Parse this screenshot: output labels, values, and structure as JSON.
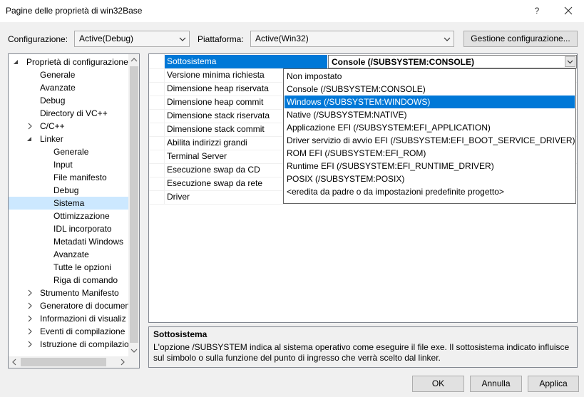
{
  "window": {
    "title": "Pagine delle proprietà di win32Base",
    "help_label": "?"
  },
  "config": {
    "configurazione_label": "Configurazione:",
    "configurazione_value": "Active(Debug)",
    "piattaforma_label": "Piattaforma:",
    "piattaforma_value": "Active(Win32)",
    "gestione_button": "Gestione configurazione..."
  },
  "tree": {
    "items": [
      {
        "label": "Proprietà di configurazione",
        "level": 0,
        "state": "expanded"
      },
      {
        "label": "Generale",
        "level": 1,
        "state": "none"
      },
      {
        "label": "Avanzate",
        "level": 1,
        "state": "none"
      },
      {
        "label": "Debug",
        "level": 1,
        "state": "none"
      },
      {
        "label": "Directory di VC++",
        "level": 1,
        "state": "none"
      },
      {
        "label": "C/C++",
        "level": 1,
        "state": "collapsed"
      },
      {
        "label": "Linker",
        "level": 1,
        "state": "expanded"
      },
      {
        "label": "Generale",
        "level": 2,
        "state": "none"
      },
      {
        "label": "Input",
        "level": 2,
        "state": "none"
      },
      {
        "label": "File manifesto",
        "level": 2,
        "state": "none"
      },
      {
        "label": "Debug",
        "level": 2,
        "state": "none"
      },
      {
        "label": "Sistema",
        "level": 2,
        "state": "none",
        "selected": true
      },
      {
        "label": "Ottimizzazione",
        "level": 2,
        "state": "none"
      },
      {
        "label": "IDL incorporato",
        "level": 2,
        "state": "none"
      },
      {
        "label": "Metadati Windows",
        "level": 2,
        "state": "none"
      },
      {
        "label": "Avanzate",
        "level": 2,
        "state": "none"
      },
      {
        "label": "Tutte le opzioni",
        "level": 2,
        "state": "none"
      },
      {
        "label": "Riga di comando",
        "level": 2,
        "state": "none"
      },
      {
        "label": "Strumento Manifesto",
        "level": 1,
        "state": "collapsed"
      },
      {
        "label": "Generatore di documen",
        "level": 1,
        "state": "collapsed"
      },
      {
        "label": "Informazioni di visualiz",
        "level": 1,
        "state": "collapsed"
      },
      {
        "label": "Eventi di compilazione",
        "level": 1,
        "state": "collapsed"
      },
      {
        "label": "Istruzione di compilazio",
        "level": 1,
        "state": "collapsed"
      }
    ]
  },
  "grid": {
    "rows": [
      {
        "name": "Sottosistema",
        "value": "Console (/SUBSYSTEM:CONSOLE)",
        "selected": true
      },
      {
        "name": "Versione minima richiesta"
      },
      {
        "name": "Dimensione heap riservata"
      },
      {
        "name": "Dimensione heap commit"
      },
      {
        "name": "Dimensione stack riservata"
      },
      {
        "name": "Dimensione stack commit"
      },
      {
        "name": "Abilita indirizzi grandi"
      },
      {
        "name": "Terminal Server"
      },
      {
        "name": "Esecuzione swap da CD"
      },
      {
        "name": "Esecuzione swap da rete"
      },
      {
        "name": "Driver"
      }
    ]
  },
  "dropdown": {
    "options": [
      "Non impostato",
      "Console (/SUBSYSTEM:CONSOLE)",
      "Windows (/SUBSYSTEM:WINDOWS)",
      "Native (/SUBSYSTEM:NATIVE)",
      "Applicazione EFI (/SUBSYSTEM:EFI_APPLICATION)",
      "Driver servizio di avvio EFI (/SUBSYSTEM:EFI_BOOT_SERVICE_DRIVER)",
      "ROM EFI (/SUBSYSTEM:EFI_ROM)",
      "Runtime EFI (/SUBSYSTEM:EFI_RUNTIME_DRIVER)",
      "POSIX (/SUBSYSTEM:POSIX)",
      "<eredita da padre o da impostazioni predefinite progetto>"
    ],
    "highlighted_index": 2
  },
  "description": {
    "title": "Sottosistema",
    "text": "L'opzione /SUBSYSTEM indica al sistema operativo come eseguire il file exe. Il sottosistema indicato influisce sul simbolo o sulla funzione del punto di ingresso che verrà scelto dal linker."
  },
  "buttons": {
    "ok": "OK",
    "annulla": "Annulla",
    "applica": "Applica"
  },
  "colors": {
    "selection_blue": "#0078d7",
    "tree_selected": "#cce8ff",
    "dialog_bg": "#f0f0f0"
  }
}
